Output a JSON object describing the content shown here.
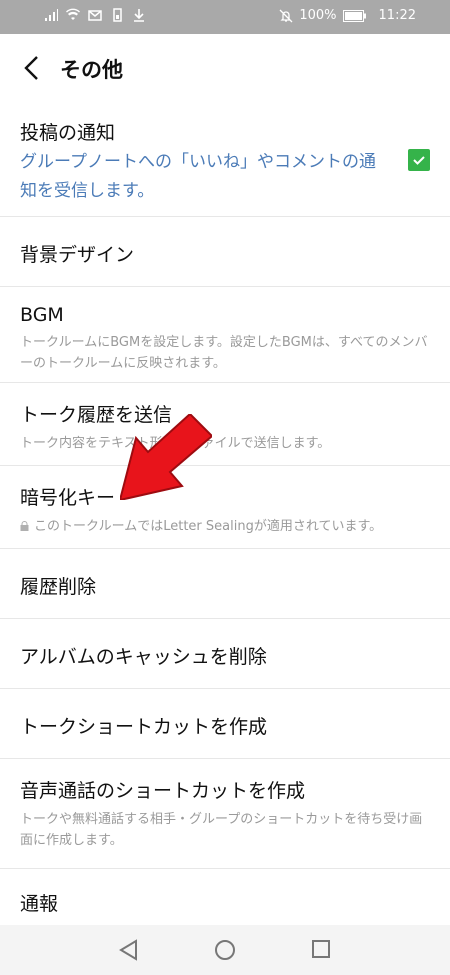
{
  "status_bar": {
    "battery": "100%",
    "time": "11:22",
    "left_icons": [
      "signal-icon",
      "wifi-icon",
      "mail-icon",
      "battery-small-icon",
      "download-icon"
    ],
    "right_icons": [
      "mute-icon",
      "battery-icon"
    ],
    "background": "#a9a9a9"
  },
  "header": {
    "title": "その他",
    "back_icon": "chevron-left-icon"
  },
  "items": [
    {
      "title": "投稿の通知",
      "desc": "グループノートへの「いいね」やコメントの通知を受信します。",
      "checked": true
    },
    {
      "title": "背景デザイン"
    },
    {
      "title": "BGM",
      "desc": "トークルームにBGMを設定します。設定したBGMは、すべてのメンバーのトークルームに反映されます。"
    },
    {
      "title": "トーク履歴を送信",
      "desc": "トーク内容をテキスト形式のファイルで送信します。"
    },
    {
      "title": "暗号化キー",
      "desc": "このトークルームではLetter Sealingが適用されています。"
    },
    {
      "title": "履歴削除"
    },
    {
      "title": "アルバムのキャッシュを削除"
    },
    {
      "title": "トークショートカットを作成"
    },
    {
      "title": "音声通話のショートカットを作成",
      "desc": "トークや無料通話する相手・グループのショートカットを待ち受け画面に作成します。"
    },
    {
      "title": "通報"
    }
  ],
  "colors": {
    "accent_link": "#4b7bb7",
    "checkbox": "#35b34a",
    "arrow": "#e8141b"
  },
  "nav_icons": [
    "back-triangle-icon",
    "home-circle-icon",
    "recents-square-icon"
  ]
}
